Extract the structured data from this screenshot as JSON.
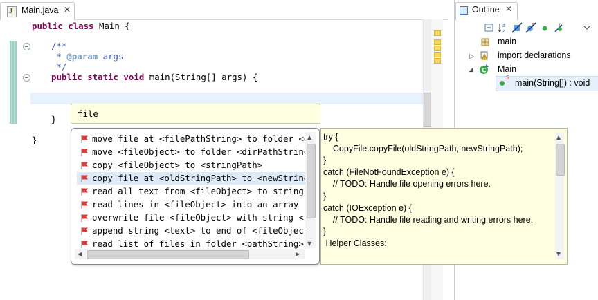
{
  "editor": {
    "tab_label": "Main.java",
    "code": {
      "l1_kw": "public class",
      "l1_rest": " Main {",
      "l2": "/**",
      "l3_star": " * ",
      "l3_tag": "@param",
      "l3_rest": " args",
      "l4": " */",
      "l5_kw": "public static void",
      "l5_rest": " main(String[] args) {",
      "l6": "}",
      "l7": "}"
    }
  },
  "outline": {
    "tab_label": "Outline",
    "items": [
      {
        "label": "main"
      },
      {
        "label": "import declarations"
      },
      {
        "label": "Main"
      },
      {
        "label": "main(String[]) : void",
        "badge": "S"
      }
    ]
  },
  "assist": {
    "filter_text": "file",
    "proposals": [
      {
        "label": "move file at <filePathString> to folder <dirPathString>"
      },
      {
        "label": "move <fileObject> to folder <dirPathString>"
      },
      {
        "label": "copy <fileObject> to <stringPath>"
      },
      {
        "label": "copy file at <oldStringPath> to <newStringPath>"
      },
      {
        "label": "read all text from <fileObject> to string"
      },
      {
        "label": "read lines in <fileObject> into an array"
      },
      {
        "label": "overwrite file <fileObject> with string <text>"
      },
      {
        "label": "append string <text> to end of <fileObject>"
      },
      {
        "label": "read list of files in folder <pathString>"
      }
    ],
    "selected_index": 3,
    "doc_lines": [
      "try {",
      "    CopyFile.copyFile(oldStringPath, newStringPath);",
      "}",
      "catch (FileNotFoundException e) {",
      "    // TODO: Handle file opening errors here.",
      "}",
      "catch (IOException e) {",
      "    // TODO: Handle file reading and writing errors here.",
      "}",
      " Helper Classes:"
    ]
  },
  "colors": {
    "keyword": "#7f0055",
    "javadoc": "#3f5fbf",
    "doc_background": "#ffffe1",
    "selection": "#ddeaf8"
  }
}
